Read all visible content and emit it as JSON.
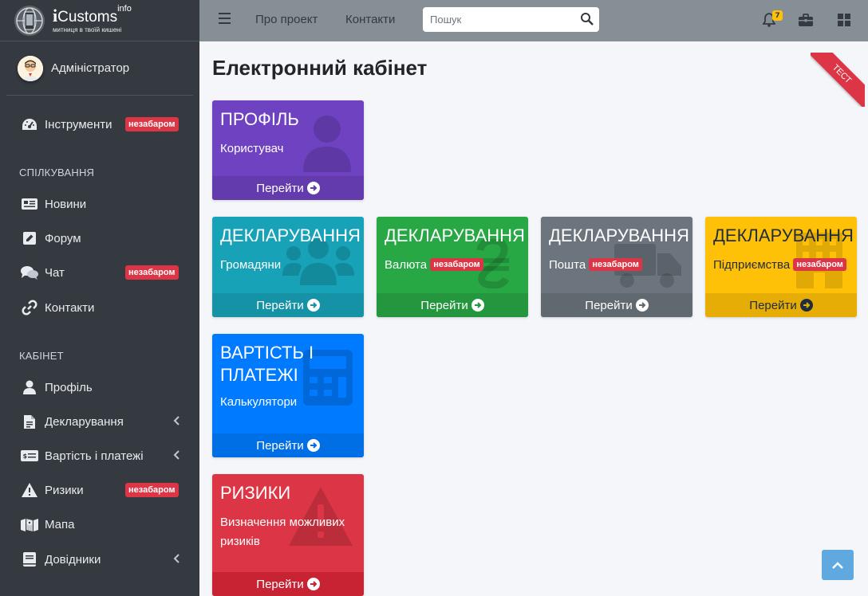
{
  "brand": {
    "i": "i",
    "name": "Customs",
    "sup": "info",
    "tagline": "митниця в твоїй кишені"
  },
  "user": {
    "name": "Адміністратор"
  },
  "sidebar": {
    "tools": {
      "label": "Інструменти",
      "badge": "незабаром",
      "icon": "tachometer-icon"
    },
    "header_communication": "СПІЛКУВАННЯ",
    "news": {
      "label": "Новини",
      "icon": "newspaper-icon"
    },
    "forum": {
      "label": "Форум",
      "icon": "edit-icon"
    },
    "chat": {
      "label": "Чат",
      "badge": "незабаром",
      "icon": "comments-icon"
    },
    "contacts": {
      "label": "Контакти",
      "icon": "link-icon"
    },
    "header_cabinet": "КАБІНЕТ",
    "profile": {
      "label": "Профіль",
      "icon": "user-icon"
    },
    "declaring": {
      "label": "Декларування",
      "icon": "file-icon"
    },
    "payments": {
      "label": "Вартість і платежі",
      "icon": "money-check-icon"
    },
    "risks": {
      "label": "Ризики",
      "badge": "незабаром",
      "icon": "warning-icon"
    },
    "map": {
      "label": "Мапа",
      "icon": "map-icon"
    },
    "references": {
      "label": "Довідники",
      "icon": "book-icon"
    }
  },
  "topbar": {
    "about": "Про проект",
    "contacts": "Контакти",
    "search_placeholder": "Пошук",
    "notifications_count": "7"
  },
  "page": {
    "title": "Електронний кабінет",
    "ribbon": "ТЕСТ"
  },
  "cards": {
    "profile": {
      "title": "ПРОФІЛЬ",
      "sub": "Користувач",
      "link": "Перейти"
    },
    "decl_citizens": {
      "title": "ДЕКЛАРУВАННЯ",
      "sub": "Громадяни",
      "link": "Перейти"
    },
    "decl_currency": {
      "title": "ДЕКЛАРУВАННЯ",
      "sub": "Валюта",
      "badge": "незабаром",
      "link": "Перейти"
    },
    "decl_post": {
      "title": "ДЕКЛАРУВАННЯ",
      "sub": "Пошта",
      "badge": "незабаром",
      "link": "Перейти"
    },
    "decl_enterprises": {
      "title": "ДЕКЛАРУВАННЯ",
      "sub": "Підприємства",
      "badge": "незабаром",
      "link": "Перейти"
    },
    "payments": {
      "title_line1": "ВАРТІСТЬ І",
      "title_line2": "ПЛАТЕЖІ",
      "sub": "Калькулятори",
      "link": "Перейти"
    },
    "risks": {
      "title": "РИЗИКИ",
      "sub": "Визначення можливих ризиків",
      "link": "Перейти"
    }
  },
  "colors": {
    "purple": "#6f42c1",
    "teal": "#17a2b8",
    "green": "#28a745",
    "gray": "#6c757d",
    "yellow": "#ffc107",
    "blue": "#007bff",
    "red": "#dc3545"
  }
}
